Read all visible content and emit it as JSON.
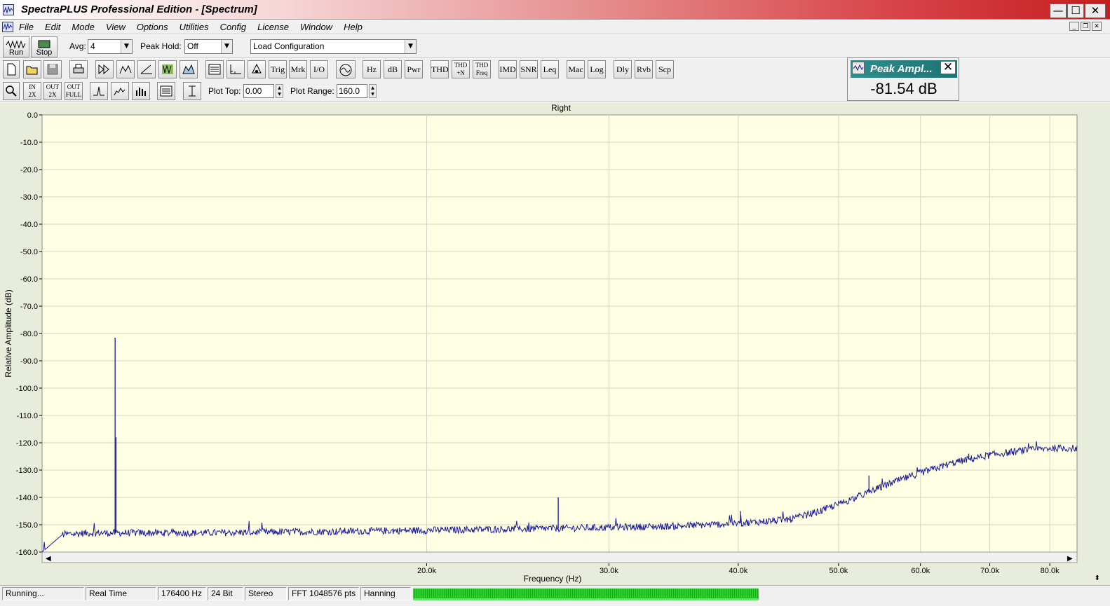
{
  "window": {
    "title": "SpectraPLUS Professional Edition - [Spectrum]",
    "min_glyph": "—",
    "max_glyph": "☐",
    "close_glyph": "✕"
  },
  "menu": {
    "items": [
      "File",
      "Edit",
      "Mode",
      "View",
      "Options",
      "Utilities",
      "Config",
      "License",
      "Window",
      "Help"
    ]
  },
  "toolbar1": {
    "run_label": "Run",
    "stop_label": "Stop",
    "avg_label": "Avg:",
    "avg_value": "4",
    "peak_hold_label": "Peak Hold:",
    "peak_hold_value": "Off",
    "config_value": "Load Configuration"
  },
  "toolbar2": {
    "trig": "Trig",
    "mrk": "Mrk",
    "io": "I/O",
    "hz": "Hz",
    "db": "dB",
    "pwr": "Pwr",
    "thd": "THD",
    "thdn_top": "THD",
    "thdn_bottom": "+N",
    "thdfreq_top": "THD",
    "thdfreq_bottom": "Freq",
    "imd": "IMD",
    "snr": "SNR",
    "leq": "Leq",
    "mac": "Mac",
    "log": "Log",
    "dly": "Dly",
    "rvb": "Rvb",
    "scp": "Scp"
  },
  "toolbar3": {
    "zoom_in_top": "IN",
    "zoom_in_bottom": "2X",
    "zoom_out_top": "OUT",
    "zoom_out_bottom": "2X",
    "zoom_full_top": "OUT",
    "zoom_full_bottom": "FULL",
    "plot_top_label": "Plot Top:",
    "plot_top_value": "0.00",
    "plot_range_label": "Plot Range:",
    "plot_range_value": "160.0"
  },
  "peak_window": {
    "title": "Peak Ampl...",
    "value": "-81.54 dB",
    "close_glyph": "✕"
  },
  "chart_data": {
    "type": "line",
    "title": "Right",
    "xlabel": "Frequency (Hz)",
    "ylabel": "Relative Amplitude (dB)",
    "xscale": "log",
    "xlim": [
      8500,
      85000
    ],
    "ylim": [
      -160,
      0
    ],
    "grid": true,
    "line_color": "#1a1a9a",
    "plot_bg": "#ffffe3",
    "y_ticks": [
      "0.0",
      "-10.0",
      "-20.0",
      "-30.0",
      "-40.0",
      "-50.0",
      "-60.0",
      "-70.0",
      "-80.0",
      "-90.0",
      "-100.0",
      "-110.0",
      "-120.0",
      "-130.0",
      "-140.0",
      "-150.0",
      "-160.0"
    ],
    "x_ticks": [
      {
        "value": 20000,
        "label": "20.0k"
      },
      {
        "value": 30000,
        "label": "30.0k"
      },
      {
        "value": 40000,
        "label": "40.0k"
      },
      {
        "value": 50000,
        "label": "50.0k"
      },
      {
        "value": 60000,
        "label": "60.0k"
      },
      {
        "value": 70000,
        "label": "70.0k"
      },
      {
        "value": 80000,
        "label": "80.0k"
      }
    ],
    "series": [
      {
        "trend_x": [
          8500,
          8900,
          9500,
          12000,
          16000,
          20000,
          25000,
          30000,
          35000,
          40000,
          45000,
          48000,
          52000,
          56000,
          60000,
          65000,
          70000,
          75000,
          80000,
          85000
        ],
        "trend_y": [
          -160,
          -153.5,
          -153,
          -153,
          -152.5,
          -152,
          -151.5,
          -151,
          -150.5,
          -149.5,
          -148,
          -145,
          -140,
          -135,
          -131,
          -127,
          -124.5,
          -123,
          -122,
          -122
        ],
        "peaks": [
          {
            "x": 10000,
            "y": -81.54
          },
          {
            "x": 10020,
            "y": -118
          },
          {
            "x": 26800,
            "y": -140
          },
          {
            "x": 53500,
            "y": -132
          },
          {
            "x": 40200,
            "y": -145
          },
          {
            "x": 66800,
            "y": -124
          }
        ]
      }
    ]
  },
  "status": {
    "state": "Running...",
    "mode": "Real Time",
    "rate": "176400 Hz",
    "bits": "24 Bit",
    "channels": "Stereo",
    "fft": "FFT 1048576 pts",
    "window": "Hanning"
  }
}
